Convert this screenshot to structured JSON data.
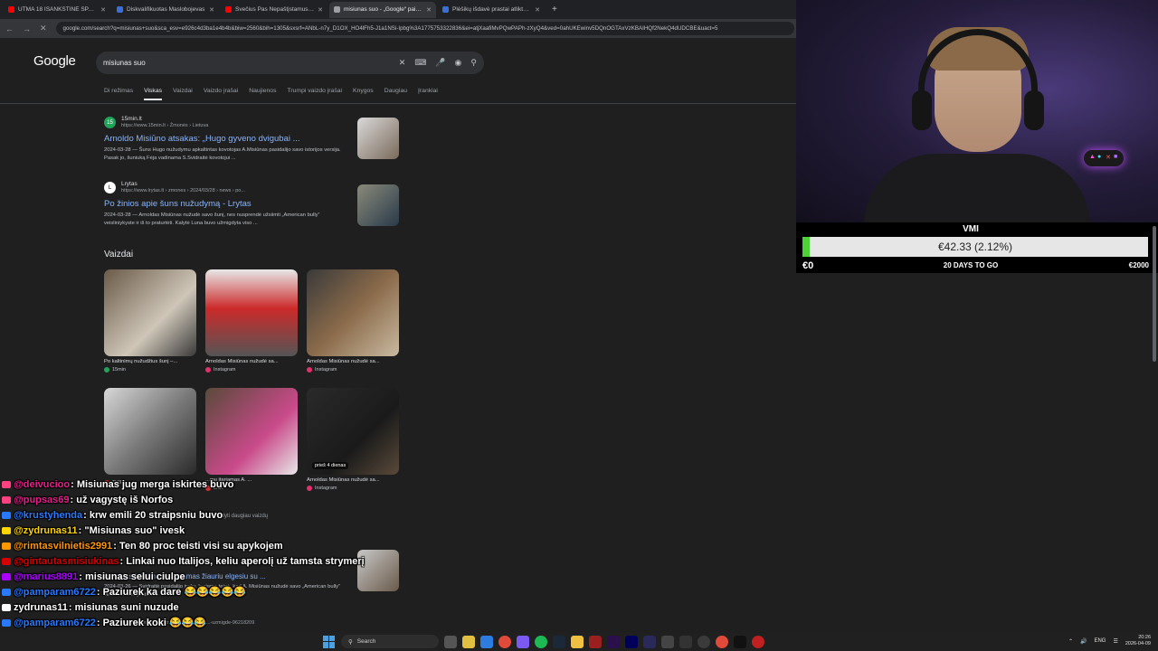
{
  "browser": {
    "tabs": [
      {
        "label": "UTMA 18 IŠANKSTINĖ SPAUDOS",
        "color": "#ff0000",
        "active": false
      },
      {
        "label": "Diskvalifikuotas Maslobojevas",
        "color": "#3a6fd8",
        "active": false
      },
      {
        "label": "Svečius Pas Nepaštįstamus IRL",
        "color": "#ff0000",
        "active": false
      },
      {
        "label": "misiunas suo - „Google“ paieška",
        "color": "#9aa0a6",
        "active": true
      },
      {
        "label": "Plėšikų išdavė prastai atliktas plaukų",
        "color": "#3a6fd8",
        "active": false
      }
    ],
    "new_tab_glyph": "+",
    "url": "google.com/search?q=misiunas+suo&sca_esv=e926c4d3ba1e4b4b&biw=2560&bih=1305&sxsrf=ANbL-n7y_D1OX_HO4lFh5-J1a1NSi-Ipbg%3A1775753322836&ei=atjXaafiMvPQwPAPh-zXyQ4&ved=0ahUKEwinv5DQnOGTAxVzKBAIHQf2NekQ4dUDCBE&uact=5"
  },
  "google": {
    "logo": "Google",
    "query": "misiunas suo",
    "tabs": [
      "Di režimas",
      "Viskas",
      "Vaizdai",
      "Vaizdo įrašai",
      "Naujienos",
      "Trumpi vaizdo įrašai",
      "Knygos",
      "Daugiau",
      "Įrankiai"
    ],
    "active_tab_index": 1,
    "results": [
      {
        "site": "15min.lt",
        "url": "https://www.15min.lt › Žmonės › Lietuva",
        "title": "Arnoldo Misiūno atsakas: „Hugo gyveno dvigubai ...",
        "snippet": "2024-03-28 — Šuns Hugo nužudymu apkaltintas kovotojas A.Misiūnas pasidalijo savo istorijos versija. Pasak jo, šuniuką Fėja vadinama S.Svidraitė kovotojui ...",
        "favicon_text": "15",
        "favicon_color": "#22a35a"
      },
      {
        "site": "Lrytas",
        "url": "https://www.lrytas.lt › zmones › 2024/03/28 › news › po...",
        "title": "Po žinios apie šuns nužudymą - Lrytas",
        "snippet": "2024-03-28 — Arnoldas Misiūnas nužudė savo šunį, nes nusprendė užsiimti „American bully“ veisliniykyste ir iš to praturtėti. Kalytė Luna buvo užmigdyta viso ...",
        "favicon_text": "L",
        "favicon_color": "#ffffff"
      }
    ],
    "images_heading": "Vaizdai",
    "images": [
      {
        "caption": "Po kaltinimų nužudžius šunį –...",
        "source": "15min",
        "source_color": "#22a35a",
        "badge": ""
      },
      {
        "caption": "Arnoldas Misiūnas nužudė sa...",
        "source": "Instagram",
        "source_color": "#e1306c",
        "badge": ""
      },
      {
        "caption": "Arnoldas Misiūnas nužudė sa...",
        "source": "Instagram",
        "source_color": "#e1306c",
        "badge": ""
      },
      {
        "caption": "",
        "source": "TV3",
        "source_color": "#d32f2f",
        "badge": ""
      },
      {
        "caption": "...mų įtariamas A. ...",
        "source": "LNK",
        "source_color": "#d32f2f",
        "badge": ""
      },
      {
        "caption": "Arnoldas Misiūnas nužudė sa...",
        "source": "Instagram",
        "source_color": "#e1306c",
        "badge": "prieš 4 dienas"
      }
    ],
    "more_images": "Rodyti daugiau vaizdų",
    "third_result": {
      "title": "Arnoldas Misiūnas kaltinamas žiauriu elgesiu su ...",
      "snippet": "2024-03-26 — Svidraitė pasidalijo įrašu, kuriame teigė, kad A. Misiūnas nužudė savo „American bully“ veislės ir iš to praturtėti"
    },
    "status_url": "...lt/gyvenimas/gyvunei-ir-naminiai/suo-pakalti-...-uzmigde-96218209"
  },
  "donation": {
    "title": "VMI",
    "amount_text": "€42.33 (2.12%)",
    "progress_percent": 2.12,
    "min_label": "€0",
    "days_label": "20 DAYS TO GO",
    "max_label": "€2000",
    "fill_color": "#4cd137"
  },
  "webcam": {
    "led_text": "PLAY"
  },
  "chat": [
    {
      "user": "@deivucioo",
      "color": "#e91e8c",
      "badge": "#ff4081",
      "text": "Misiunas jug merga iskirtes buvo"
    },
    {
      "user": "@pupsas69",
      "color": "#e91e8c",
      "badge": "#ff4081",
      "text": "už vagystę iš Norfos"
    },
    {
      "user": "@krustyhenda",
      "color": "#2979ff",
      "badge": "#2979ff",
      "text": "krw emili 20 straipsniu buvo"
    },
    {
      "user": "@zydrunas11",
      "color": "#ffd600",
      "badge": "#ffd600",
      "text": "\"Misiunas suo\" ivesk"
    },
    {
      "user": "@rimtasvilnietis2991",
      "color": "#ff9800",
      "badge": "#ff9800",
      "text": "Ten 80 proc teisti visi su apykojem"
    },
    {
      "user": "@gintautasmisiukinas",
      "color": "#d50000",
      "badge": "#d50000",
      "text": "Linkai nuo Italijos, keliu aperolį už tamsta strymerį"
    },
    {
      "user": "@marius8891",
      "color": "#aa00ff",
      "badge": "#aa00ff",
      "text": "misiunas selui ciulpe"
    },
    {
      "user": "@pamparam6722",
      "color": "#2979ff",
      "badge": "#2979ff",
      "text": "Paziurek ka dare 😂😂😂😂😂"
    },
    {
      "user": "zydrunas11",
      "color": "#ffffff",
      "badge": "#ffffff",
      "text": "misiunas suni nuzude"
    },
    {
      "user": "@pamparam6722",
      "color": "#2979ff",
      "badge": "#2979ff",
      "text": "Paziurek koki 😂😂😂"
    }
  ],
  "taskbar": {
    "search_label": "Search",
    "lang": "ENG",
    "time": "20:26",
    "date": "2026-04-09"
  }
}
